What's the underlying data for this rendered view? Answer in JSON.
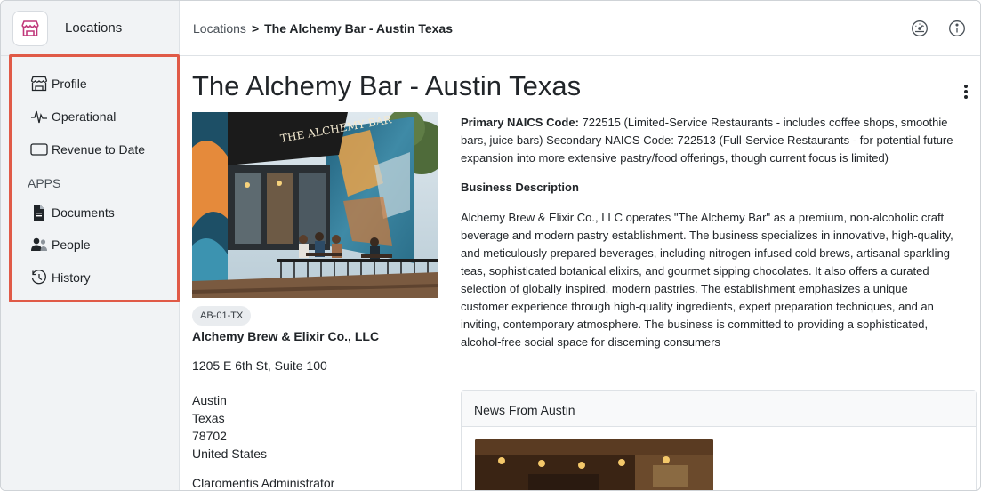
{
  "app": {
    "title": "Locations"
  },
  "sidebar": {
    "items": [
      {
        "label": "Profile",
        "icon": "storefront-icon"
      },
      {
        "label": "Operational",
        "icon": "pulse-icon"
      },
      {
        "label": "Revenue to Date",
        "icon": "rectangle-icon"
      }
    ],
    "apps_label": "APPS",
    "apps": [
      {
        "label": "Documents",
        "icon": "document-icon"
      },
      {
        "label": "People",
        "icon": "people-icon"
      },
      {
        "label": "History",
        "icon": "history-icon"
      }
    ],
    "highlight_color": "#e05a47"
  },
  "breadcrumb": {
    "root": "Locations",
    "separator": ">",
    "current": "The Alchemy Bar - Austin Texas"
  },
  "topbar_icons": [
    "dashboard-gauge-icon",
    "info-icon"
  ],
  "page": {
    "title": "The Alchemy Bar - Austin Texas",
    "photo_sign": "THE ALCHEMY BAR"
  },
  "location": {
    "code": "AB-01-TX",
    "company": "Alchemy Brew & Elixir Co., LLC",
    "street": "1205 E 6th St, Suite 100",
    "city": "Austin",
    "state": "Texas",
    "zip": "78702",
    "country": "United States",
    "contact": "Claromentis Administrator"
  },
  "naics": {
    "label": "Primary NAICS Code:",
    "text_line1": " 722515 (Limited-Service Restaurants - includes coffee shops, smoothie",
    "text_line2": "bars, juice bars) Secondary NAICS Code: 722513 (Full-Service Restaurants - for potential future",
    "text_line3": "expansion into more extensive pastry/food offerings, though current focus is limited)"
  },
  "business": {
    "heading": "Business Description",
    "lines": [
      "Alchemy Brew & Elixir Co., LLC operates \"The Alchemy Bar\" as a premium, non-alcoholic craft",
      "beverage and modern pastry establishment. The business specializes in innovative, high-quality,",
      "and meticulously prepared beverages, including nitrogen-infused cold brews, artisanal sparkling",
      "teas, sophisticated botanical elixirs, and gourmet sipping chocolates. It also offers a curated",
      "selection of globally inspired, modern pastries. The establishment emphasizes a unique",
      "customer experience through high-quality ingredients, expert preparation techniques, and an",
      "inviting, contemporary atmosphere. The business is committed to providing a sophisticated,",
      "alcohol-free social space for discerning consumers"
    ]
  },
  "news": {
    "heading": "News From Austin"
  }
}
